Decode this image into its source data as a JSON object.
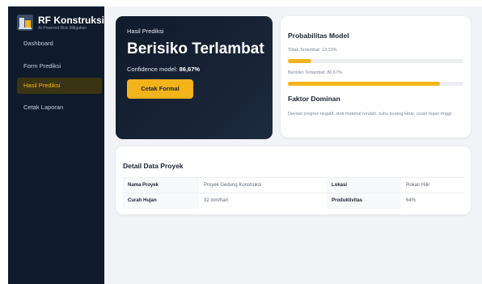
{
  "app": {
    "brand_title": "RF Konstruksi",
    "brand_subtitle": "AI-Powered Risk Mitigation"
  },
  "sidebar": {
    "items": [
      {
        "label": "Dashboard"
      },
      {
        "label": "Form Prediksi"
      },
      {
        "label": "Hasil Prediksi",
        "active": true
      },
      {
        "label": "Cetak Laporan"
      }
    ]
  },
  "result": {
    "label": "Hasil Prediksi",
    "title": "Berisiko Terlambat",
    "confidence_prefix": "Confidence model: ",
    "confidence_value": "86,67%",
    "print_button": "Cetak Formal"
  },
  "probabilities": {
    "title": "Probabilitas Model",
    "items": [
      {
        "label": "Tidak Terlambat: 13,33%",
        "value": 13.33
      },
      {
        "label": "Berisiko Terlambat: 86,67%",
        "value": 86.67
      }
    ],
    "factor_title": "Faktor Dominan",
    "factor_text": "Deviasi progres negatif, stok material rendah, suhu kurang ideal, curah hujan tinggi."
  },
  "details": {
    "title": "Detail Data Proyek",
    "rows": [
      [
        "Nama Proyek",
        "Proyek Gedung Konstruksi",
        "Lokasi",
        "Rokan Hilir"
      ],
      [
        "Curah Hujan",
        "32 mm/hari",
        "Produktivitas",
        "64%"
      ]
    ]
  },
  "colors": {
    "accent": "#f3b31b",
    "sidebar_bg": "#0f1a2b",
    "background": "#f1f3f7"
  }
}
